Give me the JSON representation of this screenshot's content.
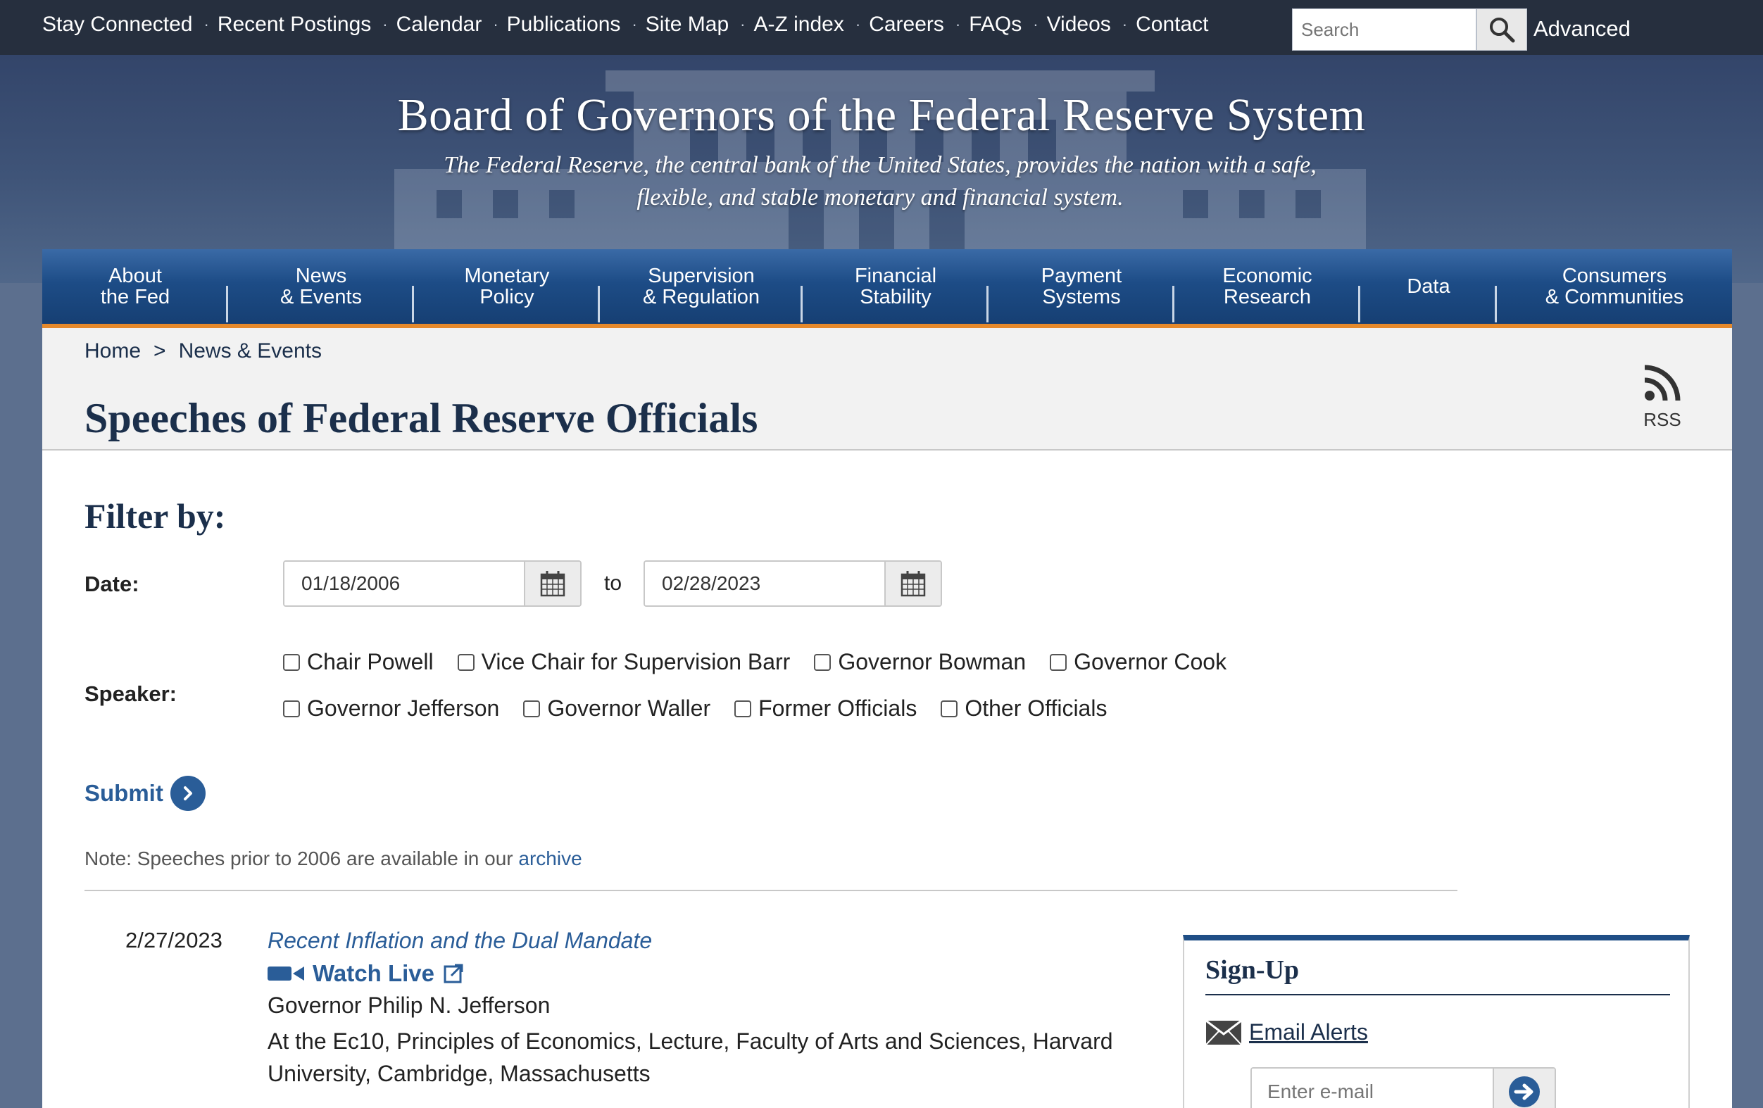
{
  "utility": {
    "links": [
      "Stay Connected",
      "Recent Postings",
      "Calendar",
      "Publications",
      "Site Map",
      "A-Z index",
      "Careers",
      "FAQs",
      "Videos",
      "Contact"
    ],
    "search_placeholder": "Search",
    "advanced_label": "Advanced"
  },
  "site": {
    "title": "Board of Governors of the Federal Reserve System",
    "tagline": "The Federal Reserve, the central bank of the United States, provides the nation with a safe, flexible, and stable monetary and financial system."
  },
  "nav": {
    "items": [
      {
        "line1": "About",
        "line2": "the Fed"
      },
      {
        "line1": "News",
        "line2": "& Events"
      },
      {
        "line1": "Monetary",
        "line2": "Policy"
      },
      {
        "line1": "Supervision",
        "line2": "& Regulation"
      },
      {
        "line1": "Financial",
        "line2": "Stability"
      },
      {
        "line1": "Payment",
        "line2": "Systems"
      },
      {
        "line1": "Economic",
        "line2": "Research"
      },
      {
        "line1": "Data",
        "line2": ""
      },
      {
        "line1": "Consumers",
        "line2": "& Communities"
      }
    ]
  },
  "breadcrumb": {
    "home": "Home",
    "separator": ">",
    "current": "News & Events"
  },
  "page": {
    "title": "Speeches of Federal Reserve Officials",
    "rss_label": "RSS"
  },
  "filter": {
    "heading": "Filter by:",
    "date_label": "Date:",
    "date_from": "01/18/2006",
    "to_label": "to",
    "date_to": "02/28/2023",
    "speaker_label": "Speaker:",
    "speakers_row1": [
      "Chair Powell",
      "Vice Chair for Supervision Barr",
      "Governor Bowman",
      "Governor Cook"
    ],
    "speakers_row2": [
      "Governor Jefferson",
      "Governor Waller",
      "Former Officials",
      "Other Officials"
    ],
    "submit_label": "Submit"
  },
  "note": {
    "text": "Note: Speeches prior to 2006 are available in our ",
    "link": "archive"
  },
  "speech": {
    "date": "2/27/2023",
    "title": "Recent Inflation and the Dual Mandate",
    "watch_live": "Watch Live",
    "speaker": "Governor Philip N. Jefferson",
    "location": "At the Ec10, Principles of Economics, Lecture, Faculty of Arts and Sciences, Harvard University, Cambridge, Massachusetts"
  },
  "signup": {
    "title": "Sign-Up",
    "email_alerts": "Email Alerts",
    "email_placeholder": "Enter e-mail"
  },
  "colors": {
    "brand_navy": "#1b2f4b",
    "link_blue": "#2a5d98",
    "nav_accent_orange": "#e5892b",
    "utility_bar": "#262f3e"
  }
}
